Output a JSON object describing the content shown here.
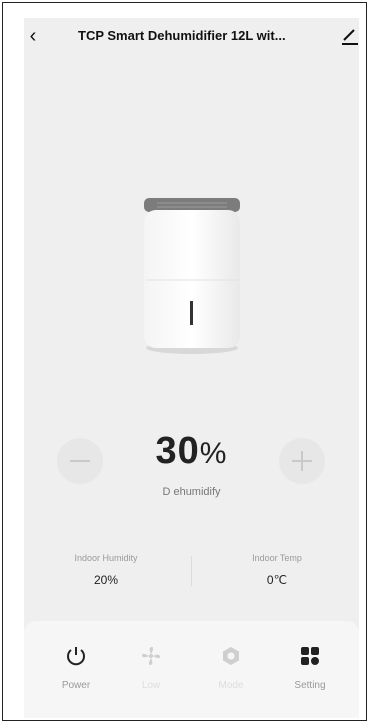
{
  "header": {
    "title": "TCP Smart Dehumidifier 12L wit..."
  },
  "control": {
    "value": "30",
    "unit": "%",
    "mode_label": "D ehumidify"
  },
  "stats": [
    {
      "label": "Indoor Humidity",
      "value": "20%"
    },
    {
      "label": "Indoor Temp",
      "value": "0℃"
    }
  ],
  "tabs": [
    {
      "label": "Power",
      "icon": "power-icon"
    },
    {
      "label": "Low",
      "icon": "fan-icon"
    },
    {
      "label": "Mode",
      "icon": "mode-icon"
    },
    {
      "label": "Setting",
      "icon": "grid-icon"
    }
  ],
  "colors": {
    "background": "#efefef",
    "text": "#222222",
    "accent_dim": "#dddddd"
  }
}
